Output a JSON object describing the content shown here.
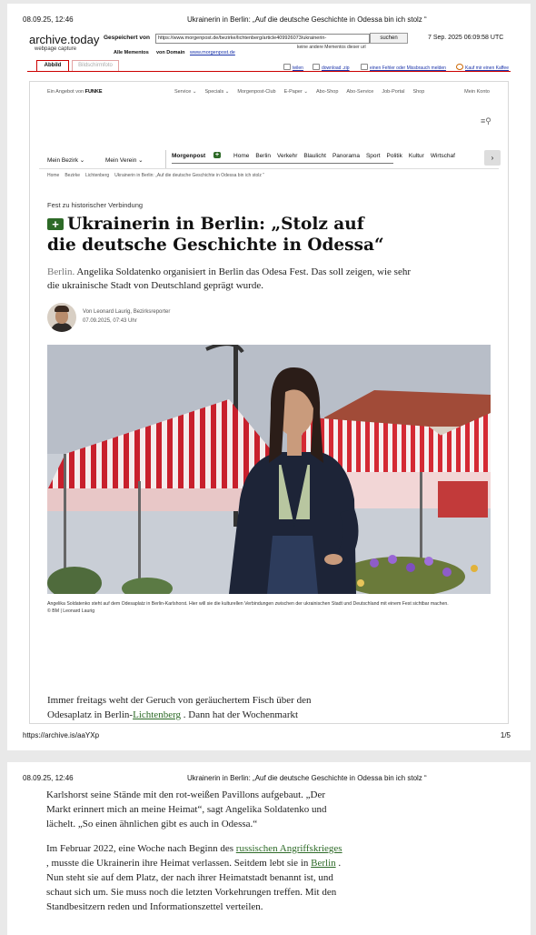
{
  "print": {
    "date": "08.09.25, 12:46",
    "title": "Ukrainerin in Berlin: „Auf die deutsche Geschichte in Odessa bin ich stolz “",
    "footer_url": "https://archive.is/aaYXp",
    "page_num": "1/5"
  },
  "archive": {
    "logo": "archive.today",
    "sub": "webpage capture",
    "saved_label": "Gespeichert von",
    "url": "https://www.morgenpost.de/bezirke/lichtenberg/article409926073/ukrainerin-",
    "search_btn": "suchen",
    "timestamp": "7 Sep. 2025 06:09:58 UTC",
    "other_mementos": "keine andere Mementos dieser url",
    "all_mementos": "Alle Mementos",
    "from_domain": "von Domain",
    "domain": "www.morgenpost.de",
    "tab_page": "Abbild",
    "tab_screenshot": "Bildschirmfoto",
    "tool_share": "teilen",
    "tool_download": "download .zip",
    "tool_report": "einen Fehler oder Missbrauch melden",
    "tool_coffee": "Kauf mir einen Kaffee"
  },
  "site": {
    "brand_prefix": "Ein Angebot von",
    "brand": "FUNKE",
    "top_items": [
      "Service ⌄",
      "Specials ⌄",
      "Morgenpost-Club",
      "E-Paper ⌄",
      "Abo-Shop",
      "Abo-Service",
      "Job-Portal",
      "Shop"
    ],
    "konto": "Mein Konto",
    "bezirk": "Mein Bezirk ⌄",
    "verein": "Mein Verein ⌄",
    "sec_items": [
      "Morgenpost",
      "Home",
      "Berlin",
      "Verkehr",
      "Blaulicht",
      "Panorama",
      "Sport",
      "Politik",
      "Kultur",
      "Wirtschaf"
    ]
  },
  "breadcrumbs": [
    "Home",
    "Bezirke",
    "Lichtenberg",
    "Ukrainerin in Berlin: „Auf die deutsche Geschichte in Odessa bin ich stolz “"
  ],
  "article": {
    "kicker": "Fest zu historischer Verbindung",
    "headline": "Ukrainerin in Berlin: „Stolz auf die deutsche Geschichte in Odessa“",
    "teaser_loc": "Berlin.",
    "teaser": " Angelika Soldatenko organisiert in Berlin das Odesa Fest. Das soll zeigen, wie sehr die ukrainische Stadt von Deutschland geprägt wurde.",
    "author": "Von Leonard Laurig, Bezirksreporter",
    "datetime": "07.09.2025, 07:43 Uhr",
    "caption": "Angelika Soldatenko steht auf dem Odesaplatz in Berlin-Karlshorst. Hier will sie die kulturellen Verbindungen zwischen der ukrainischen Stadt und Deutschland mit einem Fest sichtbar machen.",
    "credit": "© BM | Leonard Laurig",
    "p1_a": "Immer freitags weht der Geruch von geräuchertem Fisch über den Odesaplatz in Berlin-",
    "p1_link": "Lichtenberg",
    "p1_b": " . Dann hat der Wochenmarkt",
    "p1_cont": "Karlshorst seine Stände mit den rot-weißen Pavillons aufgebaut. „Der Markt erinnert mich an meine Heimat“, sagt Angelika Soldatenko und lächelt. „So einen ähnlichen gibt es auch in Odessa.“",
    "p2_a": "Im Februar 2022, eine Woche nach Beginn des ",
    "p2_link1": "russischen Angriffskrieges",
    "p2_b": " , musste die Ukrainerin ihre Heimat verlassen. Seitdem lebt sie in ",
    "p2_link2": "Berlin",
    "p2_c": " . Nun steht sie auf dem Platz, der nach ihrer Heimatstadt benannt ist, und schaut sich um. Sie muss noch die letzten Vorkehrungen treffen. Mit den Standbesitzern reden und Informationszettel verteilen."
  },
  "colors": {
    "archive_red": "#cc0000",
    "link_green": "#2d6a27"
  }
}
